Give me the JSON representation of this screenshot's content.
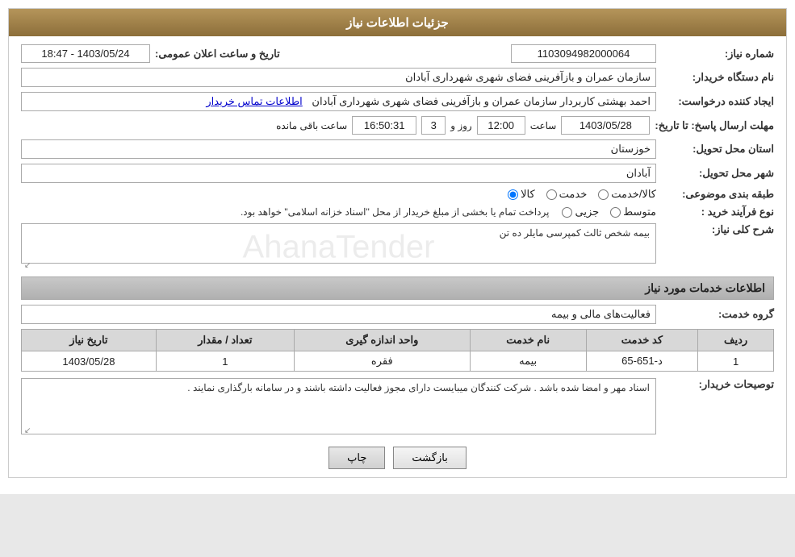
{
  "page": {
    "title": "جزئیات اطلاعات نیاز"
  },
  "header": {
    "label_title": "جزئیات اطلاعات نیاز"
  },
  "fields": {
    "label_shomare_niaz": "شماره نیاز:",
    "shomare_niaz_value": "1103094982000064",
    "label_tarikh": "تاریخ و ساعت اعلان عمومی:",
    "tarikh_value": "1403/05/24 - 18:47",
    "label_nam_dastgah": "نام دستگاه خریدار:",
    "nam_dastgah_value": "سازمان عمران و بازآفرینی فضای شهری شهرداری آبادان",
    "label_ijad_konande": "ایجاد کننده درخواست:",
    "ijad_konande_value": "احمد بهشتی کاربردار سازمان عمران و بازآفرینی فضای شهری شهرداری آبادان",
    "label_ettelaat": "اطلاعات تماس خریدار",
    "label_mohlat": "مهلت ارسال پاسخ: تا تاریخ:",
    "mohlat_date": "1403/05/28",
    "label_saat": "ساعت",
    "mohlat_saat": "12:00",
    "label_roz": "روز و",
    "mohlat_roz": "3",
    "mohlat_mande": "16:50:31",
    "label_mande": "ساعت باقی مانده",
    "label_ostan": "استان محل تحویل:",
    "ostan_value": "خوزستان",
    "label_shahr": "شهر محل تحویل:",
    "shahr_value": "آبادان",
    "label_tabaqebandi": "طبقه بندی موضوعی:",
    "radio_kala": "کالا",
    "radio_khedmat": "خدمت",
    "radio_kala_khedmat": "کالا/خدمت",
    "label_farayand": "نوع فرآیند خرید :",
    "radio_jozii": "جزیی",
    "radio_motovaset": "متوسط",
    "farayand_desc": "پرداخت تمام یا بخشی از مبلغ خریدار از محل \"اسناد خزانه اسلامی\" خواهد بود.",
    "label_sharh": "شرح کلی نیاز:",
    "sharh_value": "بیمه شخص ثالث کمپرسی مایلر ده تن",
    "section_khadamat": "اطلاعات خدمات مورد نیاز",
    "label_goroh_khedmat": "گروه خدمت:",
    "goroh_khedmat_value": "فعالیت‌های مالی و بیمه",
    "table": {
      "headers": [
        "ردیف",
        "کد خدمت",
        "نام خدمت",
        "واحد اندازه گیری",
        "تعداد / مقدار",
        "تاریخ نیاز"
      ],
      "rows": [
        {
          "radif": "1",
          "kod_khedmat": "د-651-65",
          "nam_khedmat": "بیمه",
          "vahed": "فقره",
          "tedad": "1",
          "tarikh": "1403/05/28"
        }
      ]
    },
    "label_tosif": "توصیحات خریدار:",
    "tosif_value": "اسناد مهر و امضا شده باشد . شرکت کنندگان میبایست دارای مجوز فعالیت داشته باشند و در سامانه بارگذاری نمایند ."
  },
  "buttons": {
    "chap": "چاپ",
    "bazgasht": "بازگشت"
  }
}
